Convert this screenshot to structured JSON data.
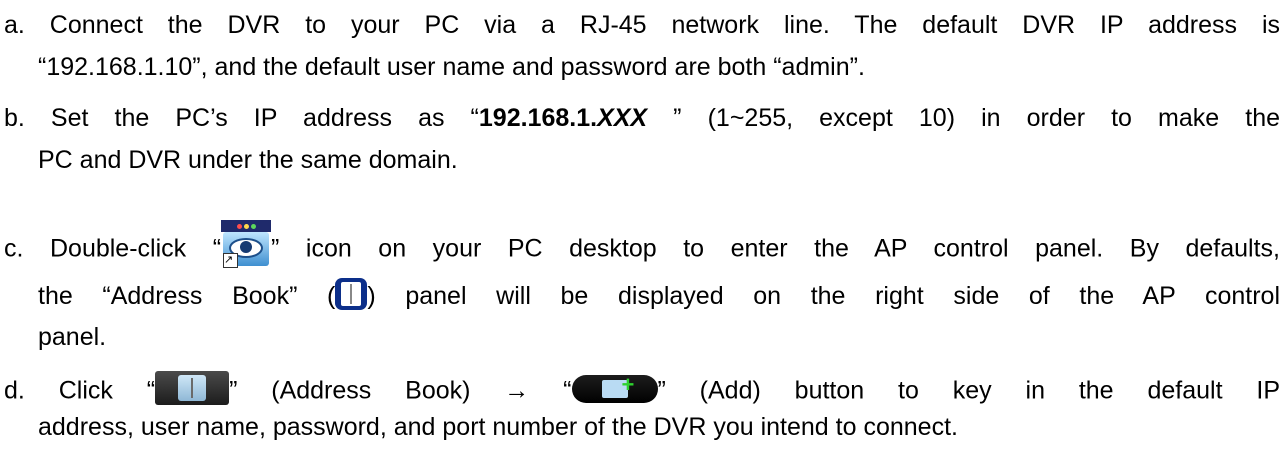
{
  "steps": {
    "a": {
      "line1": "a. Connect the DVR to your PC via a RJ-45 network line. The default DVR IP address is",
      "line2": "“192.168.1.10”, and the default user name and password are both “admin”."
    },
    "b": {
      "line1_pre": "b. Set the PC’s IP address as “",
      "ip_bold": "192.168.1.",
      "ip_italic": "XXX",
      "line1_post": " ” (1~255, except 10) in order to make the",
      "line2": "PC and DVR under the same domain."
    },
    "c": {
      "line1_pre": "c. Double-click “",
      "line1_post": "” icon on your PC desktop to enter the AP control panel. By defaults,",
      "line2_pre": "the “Address Book” (",
      "line2_post": ") panel will be displayed on the right side of the AP control",
      "line3": "panel."
    },
    "d": {
      "line1_pre": "d. Click “",
      "line1_mid": "” (Address Book)  →  “",
      "line1_post": "” (Add) button to key in the default IP",
      "line2": "address, user name, password, and port number of the DVR you intend to connect."
    }
  },
  "icons": {
    "dvr_app": "dvr-eye-icon",
    "address_book": "address-book-icon",
    "address_book_button": "address-book-button",
    "add_button": "add-button"
  }
}
